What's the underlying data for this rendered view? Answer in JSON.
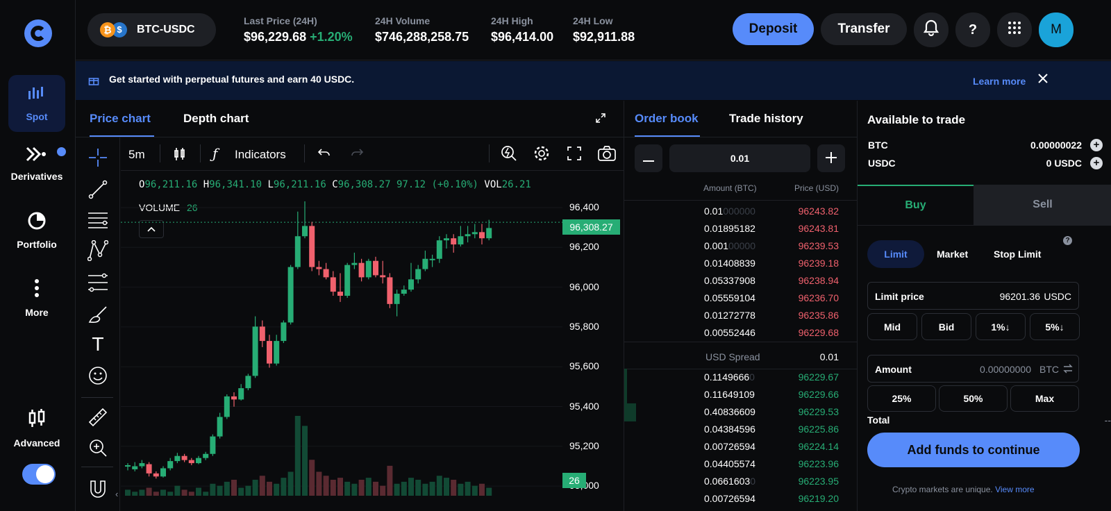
{
  "market": {
    "pair": "BTC-USDC"
  },
  "stats": [
    {
      "label": "Last Price (24H)",
      "value": "$96,229.68",
      "change": "+1.20%"
    },
    {
      "label": "24H Volume",
      "value": "$746,288,258.75"
    },
    {
      "label": "24H High",
      "value": "$96,414.00"
    },
    {
      "label": "24H Low",
      "value": "$92,911.88"
    }
  ],
  "header": {
    "deposit": "Deposit",
    "transfer": "Transfer",
    "help": "?",
    "avatar": "M"
  },
  "banner": {
    "text": "Get started with perpetual futures and earn 40 USDC.",
    "link": "Learn more"
  },
  "sidebar": {
    "items": [
      {
        "label": "Spot"
      },
      {
        "label": "Derivatives"
      },
      {
        "label": "Portfolio"
      },
      {
        "label": "More"
      },
      {
        "label": "Advanced"
      }
    ]
  },
  "chart": {
    "tabs": [
      "Price chart",
      "Depth chart"
    ],
    "interval": "5m",
    "indicators": "Indicators",
    "ohlc": {
      "o": "96,211.16",
      "h": "96,341.10",
      "l": "96,211.16",
      "c": "96,308.27",
      "chg": "97.12 (+0.10%)",
      "vol": "26.21"
    },
    "ohlc_labels": {
      "o": "O",
      "h": "H",
      "l": "L",
      "c": "C",
      "vol": "VOL"
    },
    "volume_label": "VOLUME",
    "volume_value": "26",
    "price_ticks": [
      "96,400",
      "96,200",
      "96,000",
      "95,800",
      "95,600",
      "95,400",
      "95,200",
      "95,000"
    ],
    "current_price": "96,308.27",
    "current_volume": "26"
  },
  "chart_data": {
    "type": "candlestick",
    "ylim": [
      95000,
      96420
    ],
    "candles": [
      [
        95118,
        95125,
        95100,
        95135
      ],
      [
        95105,
        95120,
        95095,
        95140
      ],
      [
        95120,
        95135,
        95110,
        95150
      ],
      [
        95130,
        95085,
        95070,
        95140
      ],
      [
        95085,
        95070,
        95060,
        95095
      ],
      [
        95070,
        95110,
        95065,
        95120
      ],
      [
        95110,
        95145,
        95100,
        95160
      ],
      [
        95145,
        95170,
        95135,
        95185
      ],
      [
        95170,
        95150,
        95140,
        95180
      ],
      [
        95150,
        95135,
        95125,
        95160
      ],
      [
        95135,
        95160,
        95130,
        95170
      ],
      [
        95160,
        95180,
        95150,
        95190
      ],
      [
        95180,
        95265,
        95170,
        95275
      ],
      [
        95265,
        95360,
        95255,
        95380
      ],
      [
        95360,
        95460,
        95350,
        95470
      ],
      [
        95460,
        95445,
        95410,
        95480
      ],
      [
        95445,
        95500,
        95440,
        95520
      ],
      [
        95500,
        95560,
        95490,
        95570
      ],
      [
        95560,
        95800,
        95550,
        95850
      ],
      [
        95800,
        95730,
        95700,
        95830
      ],
      [
        95730,
        95620,
        95600,
        95760
      ],
      [
        95620,
        95730,
        95610,
        95760
      ],
      [
        95730,
        95820,
        95720,
        95830
      ],
      [
        95820,
        96090,
        95810,
        96100
      ],
      [
        96090,
        96240,
        96080,
        96360
      ],
      [
        96240,
        96290,
        96230,
        96410
      ],
      [
        96290,
        96090,
        96070,
        96310
      ],
      [
        96090,
        96080,
        96050,
        96120
      ],
      [
        96080,
        96040,
        96030,
        96110
      ],
      [
        96040,
        95970,
        95950,
        96070
      ],
      [
        95970,
        95950,
        95920,
        96060
      ],
      [
        95950,
        96100,
        95940,
        96110
      ],
      [
        96100,
        96110,
        96080,
        96160
      ],
      [
        96110,
        96040,
        96020,
        96130
      ],
      [
        96040,
        96120,
        96030,
        96130
      ],
      [
        96120,
        96050,
        96040,
        96140
      ],
      [
        96050,
        96040,
        96010,
        96120
      ],
      [
        96040,
        95910,
        95890,
        96060
      ],
      [
        95910,
        95960,
        95850,
        95980
      ],
      [
        95960,
        95980,
        95950,
        96000
      ],
      [
        95980,
        96030,
        95970,
        96110
      ],
      [
        96030,
        96080,
        96010,
        96100
      ],
      [
        96080,
        96130,
        96070,
        96170
      ],
      [
        96130,
        96130,
        96090,
        96150
      ],
      [
        96130,
        96220,
        96110,
        96240
      ],
      [
        96220,
        96230,
        96180,
        96250
      ],
      [
        96230,
        96200,
        96160,
        96250
      ],
      [
        96200,
        96240,
        96190,
        96290
      ],
      [
        96240,
        96250,
        96210,
        96290
      ],
      [
        96250,
        96260,
        96230,
        96300
      ],
      [
        96260,
        96230,
        96200,
        96300
      ],
      [
        96230,
        96280,
        96220,
        96320
      ]
    ],
    "volumes": [
      3,
      2,
      3,
      4,
      2,
      3,
      2,
      5,
      3,
      2,
      4,
      2,
      6,
      5,
      7,
      8,
      4,
      5,
      8,
      10,
      7,
      6,
      9,
      12,
      40,
      35,
      18,
      12,
      10,
      8,
      9,
      7,
      6,
      8,
      9,
      7,
      5,
      15,
      6,
      7,
      9,
      8,
      6,
      7,
      10,
      9,
      8,
      6,
      7,
      5,
      6,
      4
    ]
  },
  "orderbook": {
    "tabs": [
      "Order book",
      "Trade history"
    ],
    "step": "0.01",
    "col_amount": "Amount (BTC)",
    "col_price": "Price (USD)",
    "asks": [
      {
        "amount": "0.01",
        "dim": "000000",
        "price": "96243.82"
      },
      {
        "amount": "0.01895182",
        "dim": "",
        "price": "96243.81"
      },
      {
        "amount": "0.001",
        "dim": "00000",
        "price": "96239.53"
      },
      {
        "amount": "0.01408839",
        "dim": "",
        "price": "96239.18"
      },
      {
        "amount": "0.05337908",
        "dim": "",
        "price": "96238.94"
      },
      {
        "amount": "0.05559104",
        "dim": "",
        "price": "96236.70"
      },
      {
        "amount": "0.01272778",
        "dim": "",
        "price": "96235.86"
      },
      {
        "amount": "0.00552446",
        "dim": "",
        "price": "96229.68"
      }
    ],
    "spread_label": "USD Spread",
    "spread_value": "0.01",
    "bids": [
      {
        "amount": "0.1149666",
        "dim": "0",
        "price": "96229.67"
      },
      {
        "amount": "0.11649109",
        "dim": "",
        "price": "96229.66"
      },
      {
        "amount": "0.40836609",
        "dim": "",
        "price": "96229.53"
      },
      {
        "amount": "0.04384596",
        "dim": "",
        "price": "96225.86"
      },
      {
        "amount": "0.00726594",
        "dim": "",
        "price": "96224.14"
      },
      {
        "amount": "0.04405574",
        "dim": "",
        "price": "96223.96"
      },
      {
        "amount": "0.0661603",
        "dim": "0",
        "price": "96223.95"
      },
      {
        "amount": "0.00726594",
        "dim": "",
        "price": "96219.20"
      }
    ]
  },
  "trade": {
    "title": "Available to trade",
    "balances": [
      {
        "asset": "BTC",
        "amount": "0.00000022"
      },
      {
        "asset": "USDC",
        "amount": "0 USDC"
      }
    ],
    "buy": "Buy",
    "sell": "Sell",
    "order_types": [
      "Limit",
      "Market",
      "Stop Limit"
    ],
    "limit_price_label": "Limit price",
    "limit_price_value": "96201.36",
    "limit_price_unit": "USDC",
    "quick_prices": [
      "Mid",
      "Bid",
      "1%↓",
      "5%↓"
    ],
    "amount_label": "Amount",
    "amount_value": "0.00000000",
    "amount_unit": "BTC",
    "percents": [
      "25%",
      "50%",
      "Max"
    ],
    "total_label": "Total",
    "total_value": "--",
    "cta": "Add funds to continue",
    "footer_text": "Crypto markets are unique.",
    "footer_link": "View more"
  },
  "colors": {
    "green": "#27ad75",
    "red": "#f0616d",
    "accent": "#578bfa",
    "bg": "#0a0b0d",
    "panel": "#1a1c21"
  }
}
